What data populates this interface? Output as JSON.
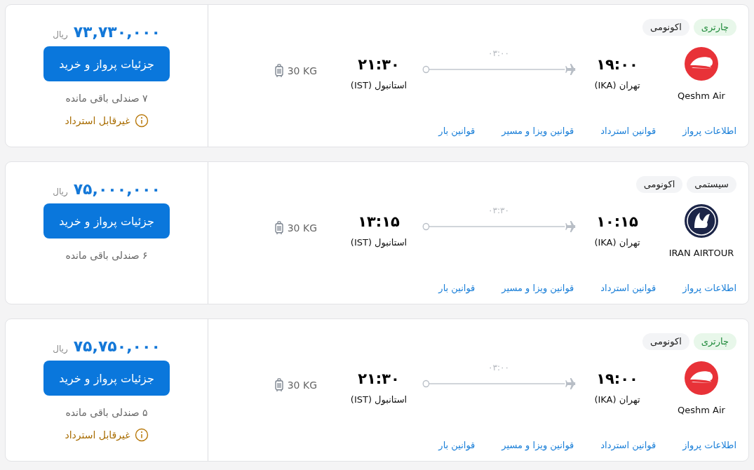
{
  "flights": [
    {
      "tags": [
        {
          "label": "چارتری",
          "kind": "charter"
        },
        {
          "label": "اکونومی",
          "kind": "class"
        }
      ],
      "airline": {
        "name": "Qeshm Air",
        "kind": "swoosh",
        "color": "#e83238"
      },
      "depart": {
        "time": "۱۹:۰۰",
        "city": "تهران (IKA)"
      },
      "duration": "۰۳:۰۰",
      "arrive": {
        "time": "۲۱:۳۰",
        "city": "استانبول (IST)"
      },
      "baggage": "30 KG",
      "links": [
        "اطلاعات پرواز",
        "قوانین استرداد",
        "قوانین ویزا و مسیر",
        "قوانین بار"
      ],
      "price": "۷۳,۷۳۰,۰۰۰",
      "currency": "ریال",
      "button": "جزئیات پرواز و خرید",
      "seats": "۷ صندلی باقی مانده",
      "refund_note": "غیرقابل استرداد"
    },
    {
      "tags": [
        {
          "label": "سیستمی",
          "kind": "system"
        },
        {
          "label": "اکونومی",
          "kind": "class"
        }
      ],
      "airline": {
        "name": "IRAN AIRTOUR",
        "kind": "emblem",
        "color": "#1c2548"
      },
      "depart": {
        "time": "۱۰:۱۵",
        "city": "تهران (IKA)"
      },
      "duration": "۰۳:۳۰",
      "arrive": {
        "time": "۱۳:۱۵",
        "city": "استانبول (IST)"
      },
      "baggage": "30 KG",
      "links": [
        "اطلاعات پرواز",
        "قوانین استرداد",
        "قوانین ویزا و مسیر",
        "قوانین بار"
      ],
      "price": "۷۵,۰۰۰,۰۰۰",
      "currency": "ریال",
      "button": "جزئیات پرواز و خرید",
      "seats": "۶ صندلی باقی مانده"
    },
    {
      "tags": [
        {
          "label": "چارتری",
          "kind": "charter"
        },
        {
          "label": "اکونومی",
          "kind": "class"
        }
      ],
      "airline": {
        "name": "Qeshm Air",
        "kind": "swoosh",
        "color": "#e83238"
      },
      "depart": {
        "time": "۱۹:۰۰",
        "city": "تهران (IKA)"
      },
      "duration": "۰۳:۰۰",
      "arrive": {
        "time": "۲۱:۳۰",
        "city": "استانبول (IST)"
      },
      "baggage": "30 KG",
      "links": [
        "اطلاعات پرواز",
        "قوانین استرداد",
        "قوانین ویزا و مسیر",
        "قوانین بار"
      ],
      "price": "۷۵,۷۵۰,۰۰۰",
      "currency": "ریال",
      "button": "جزئیات پرواز و خرید",
      "seats": "۵ صندلی باقی مانده",
      "refund_note": "غیرقابل استرداد"
    }
  ]
}
